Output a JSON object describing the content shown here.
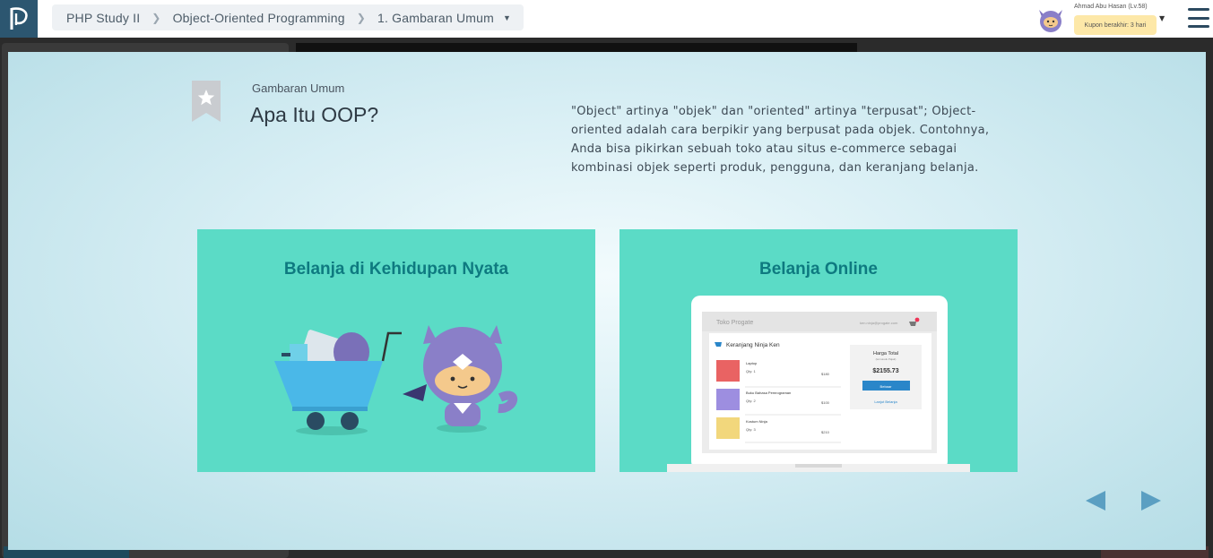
{
  "breadcrumb": {
    "course": "PHP Study II",
    "chapter": "Object-Oriented Programming",
    "section": "1. Gambaran Umum"
  },
  "user": {
    "name": "Ahmad Abu Hasan (Lv.58)",
    "coupon": "Kupon berakhir: 3 hari"
  },
  "slide": {
    "subtitle": "Gambaran Umum",
    "title": "Apa Itu OOP?",
    "description": "\"Object\" artinya \"objek\" dan \"oriented\" artinya \"terpusat\"; Object-oriented adalah cara berpikir yang berpusat pada objek. Contohnya, Anda bisa pikirkan sebuah toko atau situs e-commerce sebagai kombinasi objek seperti produk, pengguna, dan keranjang belanja.",
    "card_left_title": "Belanja di Kehidupan Nyata",
    "card_right_title": "Belanja Online"
  },
  "shop": {
    "store_name": "Toko Progate",
    "email": "ken.ninja@progate.com",
    "cart_title": "Keranjang Ninja Ken",
    "items": [
      {
        "name": "Laptop",
        "qty": "Qty: 1",
        "price": "$180"
      },
      {
        "name": "Buku Bahasa Pemrograman",
        "qty": "Qty: 2",
        "price": "$100"
      },
      {
        "name": "Kostum Ninja",
        "qty": "Qty: 3",
        "price": "$210"
      }
    ],
    "total_label": "Harga Total",
    "total_sub": "(termasuk Pajak)",
    "total_value": "$2155.73",
    "checkout_label": "Bebaar",
    "continue_label": "Lanjut Belanja"
  },
  "icons": {
    "logo": "progate-logo-icon",
    "ribbon": "bookmark-star-icon",
    "prev": "triangle-left-icon",
    "next": "triangle-right-icon",
    "menu": "hamburger-menu-icon"
  },
  "colors": {
    "brand": "#2c5670",
    "card": "#5bdbc6",
    "card_title": "#0e7a80",
    "nav_arrow": "#5b9fc2",
    "coupon_bg": "#fde8a8"
  }
}
